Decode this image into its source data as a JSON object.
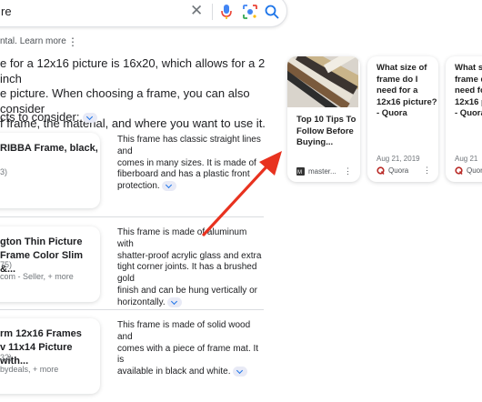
{
  "search": {
    "query": "re"
  },
  "header": {
    "text_partial": "ntal.",
    "learn_more": "Learn more"
  },
  "answer": {
    "line1": "e for a 12x16 picture is 16x20, which allows for a 2 inch",
    "line2": "e picture. When choosing a frame, you can also consider",
    "line3": "f frame, the material, and where you want to use it."
  },
  "products_heading": "cts to consider:",
  "products": [
    {
      "title_line1": "RIBBA Frame, black,",
      "meta": "3)",
      "description": [
        "This frame has classic straight lines and",
        "comes in many sizes. It is made of",
        "fiberboard and has a plastic front",
        "protection."
      ]
    },
    {
      "title_line1": "gton Thin Picture",
      "title_line2": "Frame Color Slim &...",
      "meta1": "75)",
      "meta2": "com - Seller, + more",
      "description": [
        "This frame is made of aluminum with",
        "shatter-proof acrylic glass and extra",
        "tight corner joints. It has a brushed gold",
        "finish and can be hung vertically or",
        "horizontally."
      ]
    },
    {
      "title_line1": "rm 12x16 Frames",
      "title_line2": "v 11x14 Picture with...",
      "meta1": "32)",
      "meta2": "bydeals, + more",
      "description": [
        "This frame is made of solid wood and",
        "comes with a piece of frame mat. It is",
        "available in black and white."
      ]
    }
  ],
  "sources": [
    {
      "title": [
        "Top 10 Tips To",
        "Follow Before",
        "Buying..."
      ],
      "source": "master..."
    },
    {
      "title": [
        "What size of",
        "frame do I",
        "need for a",
        "12x16 picture?",
        "- Quora"
      ],
      "date": "Aug 21, 2019",
      "source": "Quora"
    },
    {
      "title": [
        "What si",
        "frame d",
        "need fo",
        "12x16 p",
        "- Quora"
      ],
      "date": "Aug 21",
      "source": "Quora"
    }
  ],
  "colors": {
    "accent": "#1a73e8",
    "arrow": "#e8321f",
    "quora": "#b92b27"
  }
}
